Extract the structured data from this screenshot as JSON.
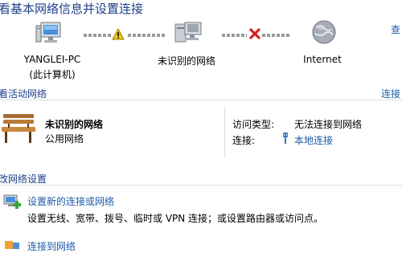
{
  "header": {
    "title": "看基本网络信息并设置连接",
    "right_link": "查"
  },
  "map": {
    "nodes": [
      {
        "name": "YANGLEI-PC",
        "subtitle": "(此计算机)"
      },
      {
        "name": "未识别的网络",
        "subtitle": ""
      },
      {
        "name": "Internet",
        "subtitle": ""
      }
    ],
    "icons": [
      "computer-icon",
      "warning-icon",
      "network-icon",
      "error-x-icon",
      "globe-icon"
    ]
  },
  "active": {
    "section_title": "看活动网络",
    "right_link": "连接",
    "network_name": "未识别的网络",
    "network_type": "公用网络",
    "access_type_label": "访问类型:",
    "access_type_value": "无法连接到网络",
    "connection_label": "连接:",
    "connection_value": "本地连接"
  },
  "settings": {
    "section_title": "改网络设置",
    "items": [
      {
        "title": "设置新的连接或网络",
        "desc": "设置无线、宽带、拨号、临时或 VPN 连接；或设置路由器或访问点。"
      },
      {
        "title": "连接到网络",
        "desc": ""
      }
    ]
  },
  "colors": {
    "title": "#1e3f8a",
    "link": "#1e5aa8",
    "warning": "#f2c521",
    "error": "#d92020",
    "separator": "#d9dde6"
  }
}
